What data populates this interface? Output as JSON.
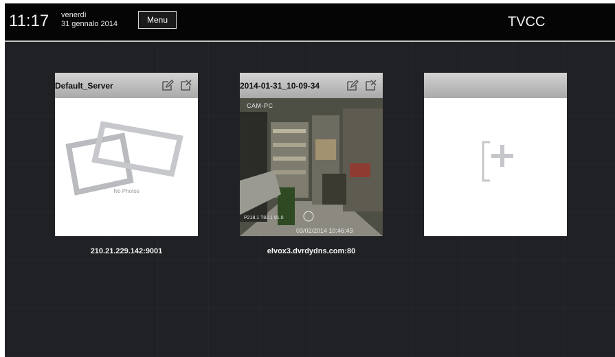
{
  "status_bar": {
    "time": "11:17",
    "weekday": "venerdì",
    "date": "31 gennalo 2014",
    "menu_label": "Menu",
    "app_title": "TVCC"
  },
  "servers": [
    {
      "name": "Default_Server",
      "address": "210.21.229.142:9001",
      "preview": "no-photos",
      "preview_text": "No Photos"
    },
    {
      "name": "2014-01-31_10-09-34",
      "address": "elvox3.dvrdydns.com:80",
      "preview": "camera-snapshot",
      "overlay_top": "CAM-PC",
      "overlay_bottom": "03/02/2014 10:46:43",
      "overlay_left": "P218.1 T82.1 91.0"
    }
  ],
  "add_tile": {
    "icon": "add-server-icon"
  },
  "icons": {
    "edit": "edit-icon",
    "delete": "delete-icon"
  },
  "colors": {
    "background": "#1e2023",
    "top_bar": "#050505",
    "tile_header": "#bdbdbd",
    "tile_body": "#ffffff"
  }
}
